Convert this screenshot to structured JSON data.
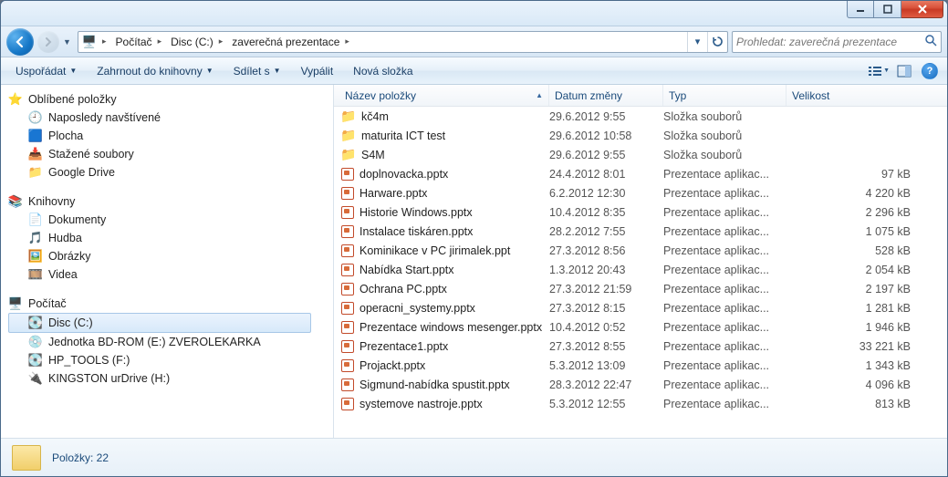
{
  "address": {
    "root_icon": "computer",
    "crumbs": [
      "Počítač",
      "Disc (C:)",
      "zaverečná prezentace"
    ]
  },
  "search": {
    "placeholder": "Prohledat: zaverečná prezentace"
  },
  "toolbar": {
    "organize": "Uspořádat",
    "include": "Zahrnout do knihovny",
    "share": "Sdílet s",
    "burn": "Vypálit",
    "newfolder": "Nová složka"
  },
  "columns": {
    "name": "Název položky",
    "date": "Datum změny",
    "type": "Typ",
    "size": "Velikost"
  },
  "sidebar": {
    "fav_title": "Oblíbené položky",
    "fav_items": [
      {
        "icon": "recent",
        "label": "Naposledy navštívené"
      },
      {
        "icon": "desktop",
        "label": "Plocha"
      },
      {
        "icon": "downloads",
        "label": "Stažené soubory"
      },
      {
        "icon": "gdrive",
        "label": "Google Drive"
      }
    ],
    "lib_title": "Knihovny",
    "lib_items": [
      {
        "icon": "doc",
        "label": "Dokumenty"
      },
      {
        "icon": "music",
        "label": "Hudba"
      },
      {
        "icon": "pic",
        "label": "Obrázky"
      },
      {
        "icon": "video",
        "label": "Videa"
      }
    ],
    "pc_title": "Počítač",
    "pc_items": [
      {
        "icon": "disk",
        "label": "Disc (C:)",
        "selected": true
      },
      {
        "icon": "bd",
        "label": "Jednotka BD-ROM (E:) ZVEROLEKARKA"
      },
      {
        "icon": "disk",
        "label": "HP_TOOLS (F:)"
      },
      {
        "icon": "usb",
        "label": "KINGSTON urDrive (H:)"
      }
    ]
  },
  "files": [
    {
      "icon": "folder",
      "name": "kč4m",
      "date": "29.6.2012 9:55",
      "type": "Složka souborů",
      "size": ""
    },
    {
      "icon": "folder",
      "name": "maturita ICT test",
      "date": "29.6.2012 10:58",
      "type": "Složka souborů",
      "size": ""
    },
    {
      "icon": "folder",
      "name": "S4M",
      "date": "29.6.2012 9:55",
      "type": "Složka souborů",
      "size": ""
    },
    {
      "icon": "pptx",
      "name": "doplnovacka.pptx",
      "date": "24.4.2012 8:01",
      "type": "Prezentace aplikac...",
      "size": "97 kB"
    },
    {
      "icon": "pptx",
      "name": "Harware.pptx",
      "date": "6.2.2012 12:30",
      "type": "Prezentace aplikac...",
      "size": "4 220 kB"
    },
    {
      "icon": "pptx",
      "name": "Historie Windows.pptx",
      "date": "10.4.2012 8:35",
      "type": "Prezentace aplikac...",
      "size": "2 296 kB"
    },
    {
      "icon": "pptx",
      "name": "Instalace tiskáren.pptx",
      "date": "28.2.2012 7:55",
      "type": "Prezentace aplikac...",
      "size": "1 075 kB"
    },
    {
      "icon": "pptx",
      "name": "Kominikace v PC jirimalek.ppt",
      "date": "27.3.2012 8:56",
      "type": "Prezentace aplikac...",
      "size": "528 kB"
    },
    {
      "icon": "pptx",
      "name": "Nabídka Start.pptx",
      "date": "1.3.2012 20:43",
      "type": "Prezentace aplikac...",
      "size": "2 054 kB"
    },
    {
      "icon": "pptx",
      "name": "Ochrana PC.pptx",
      "date": "27.3.2012 21:59",
      "type": "Prezentace aplikac...",
      "size": "2 197 kB"
    },
    {
      "icon": "pptx",
      "name": "operacni_systemy.pptx",
      "date": "27.3.2012 8:15",
      "type": "Prezentace aplikac...",
      "size": "1 281 kB"
    },
    {
      "icon": "pptx",
      "name": "Prezentace windows mesenger.pptx",
      "date": "10.4.2012 0:52",
      "type": "Prezentace aplikac...",
      "size": "1 946 kB"
    },
    {
      "icon": "pptx",
      "name": "Prezentace1.pptx",
      "date": "27.3.2012 8:55",
      "type": "Prezentace aplikac...",
      "size": "33 221 kB"
    },
    {
      "icon": "pptx",
      "name": "Projackt.pptx",
      "date": "5.3.2012 13:09",
      "type": "Prezentace aplikac...",
      "size": "1 343 kB"
    },
    {
      "icon": "pptx",
      "name": "Sigmund-nabídka spustit.pptx",
      "date": "28.3.2012 22:47",
      "type": "Prezentace aplikac...",
      "size": "4 096 kB"
    },
    {
      "icon": "pptx",
      "name": "systemove nastroje.pptx",
      "date": "5.3.2012 12:55",
      "type": "Prezentace aplikac...",
      "size": "813 kB"
    }
  ],
  "status": {
    "count_label": "Položky: 22"
  }
}
